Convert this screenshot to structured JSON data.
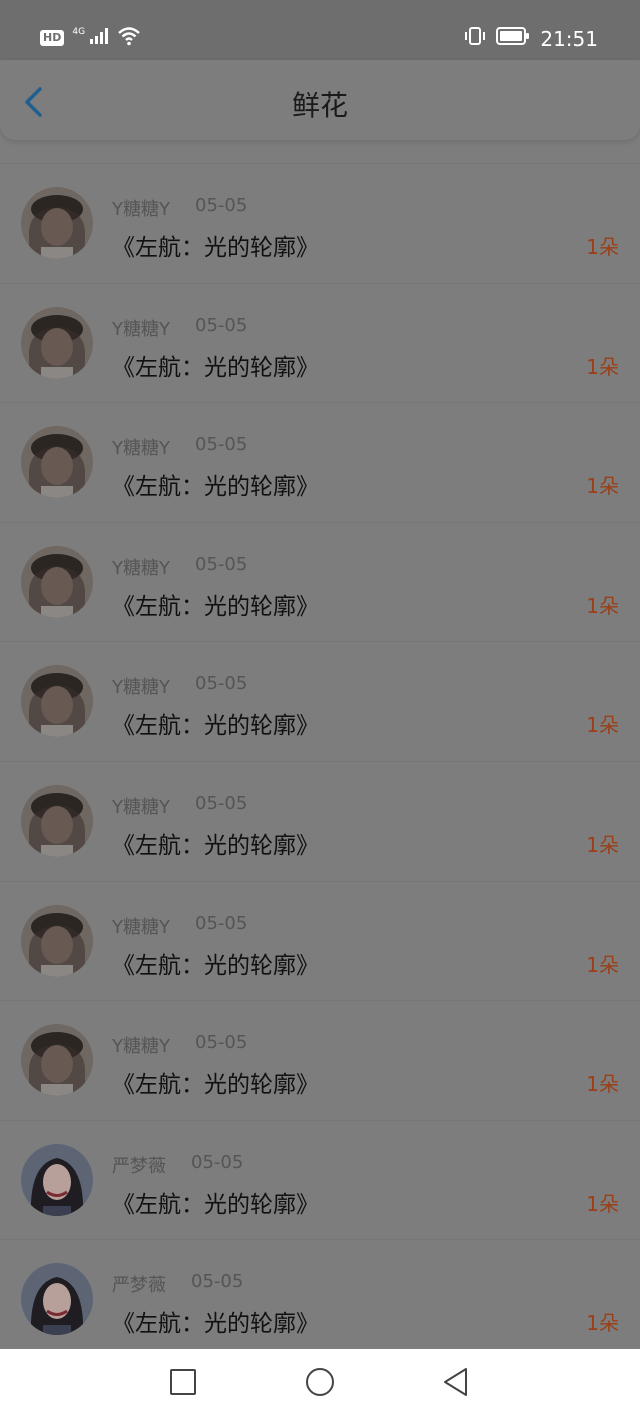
{
  "status_bar": {
    "hd_badge": "HD",
    "network": "4G",
    "time": "21:51",
    "icons": [
      "signal-icon",
      "wifi-icon",
      "vibrate-icon",
      "battery-icon"
    ]
  },
  "header": {
    "title": "鲜花",
    "back_icon": "chevron-left-icon",
    "accent_color": "#1f5f8f"
  },
  "records": [
    {
      "name": "Y糖糖Y",
      "date": "05-05",
      "work": "《左航：光的轮廓》",
      "count": "1朵",
      "avatar": "avatar-a"
    },
    {
      "name": "Y糖糖Y",
      "date": "05-05",
      "work": "《左航：光的轮廓》",
      "count": "1朵",
      "avatar": "avatar-a"
    },
    {
      "name": "Y糖糖Y",
      "date": "05-05",
      "work": "《左航：光的轮廓》",
      "count": "1朵",
      "avatar": "avatar-a"
    },
    {
      "name": "Y糖糖Y",
      "date": "05-05",
      "work": "《左航：光的轮廓》",
      "count": "1朵",
      "avatar": "avatar-a"
    },
    {
      "name": "Y糖糖Y",
      "date": "05-05",
      "work": "《左航：光的轮廓》",
      "count": "1朵",
      "avatar": "avatar-a"
    },
    {
      "name": "Y糖糖Y",
      "date": "05-05",
      "work": "《左航：光的轮廓》",
      "count": "1朵",
      "avatar": "avatar-a"
    },
    {
      "name": "Y糖糖Y",
      "date": "05-05",
      "work": "《左航：光的轮廓》",
      "count": "1朵",
      "avatar": "avatar-a"
    },
    {
      "name": "Y糖糖Y",
      "date": "05-05",
      "work": "《左航：光的轮廓》",
      "count": "1朵",
      "avatar": "avatar-a"
    },
    {
      "name": "严梦薇",
      "date": "05-05",
      "work": "《左航：光的轮廓》",
      "count": "1朵",
      "avatar": "avatar-b"
    },
    {
      "name": "严梦薇",
      "date": "05-05",
      "work": "《左航：光的轮廓》",
      "count": "1朵",
      "avatar": "avatar-b"
    }
  ],
  "colors": {
    "overlay_background": "#7d7d7d",
    "count_color": "#9a3f17",
    "navbar_background": "#ffffff"
  },
  "nav_bar": {
    "icons": [
      "recent-apps-icon",
      "home-icon",
      "back-triangle-icon"
    ]
  }
}
